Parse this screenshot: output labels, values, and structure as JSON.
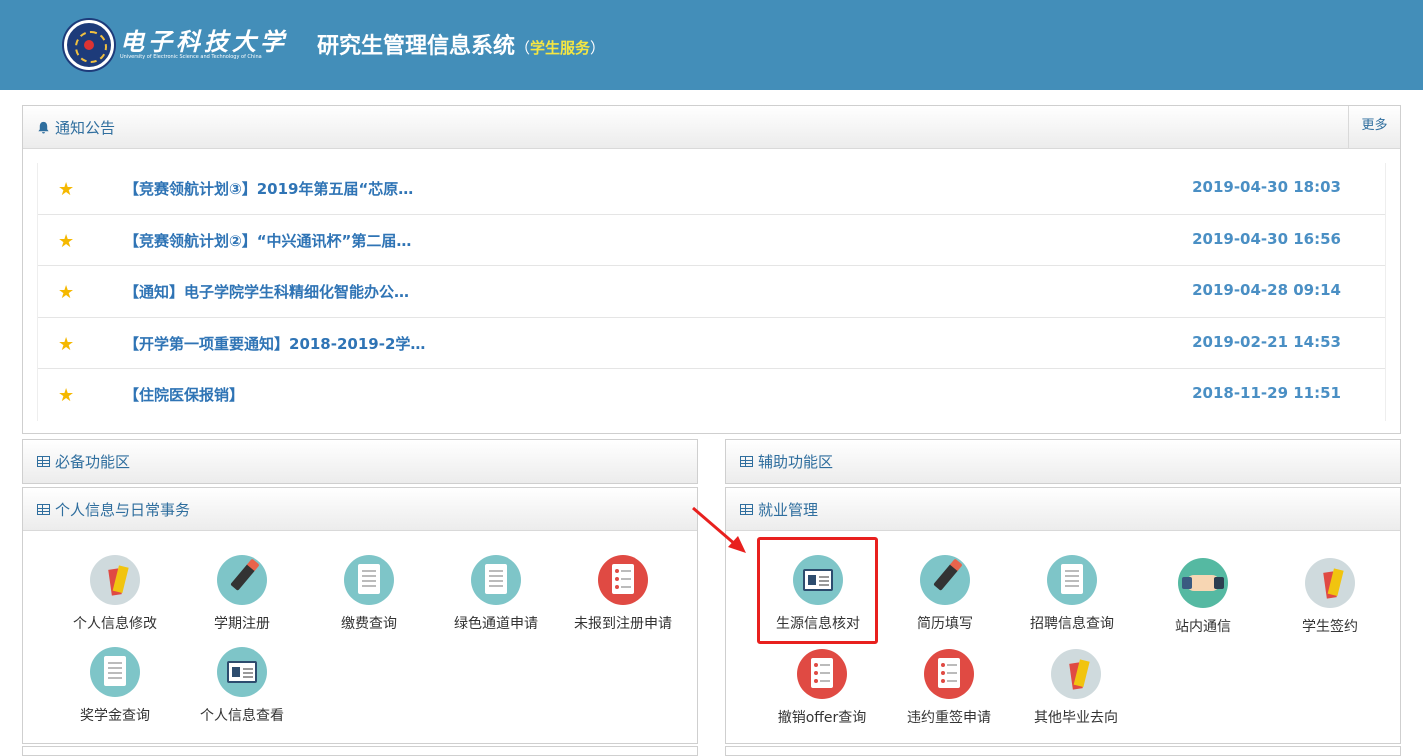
{
  "header": {
    "logo_cn": "电子科技大学",
    "logo_en": "University of Electronic Science and Technology of China",
    "title": "研究生管理信息系统",
    "sub_open": "（",
    "sub_label": "学生服务",
    "sub_close": "）"
  },
  "notice": {
    "title": "通知公告",
    "more": "更多",
    "items": [
      {
        "title": "【竞赛领航计划③】2019年第五届“芯原…",
        "date": "2019-04-30 18:03"
      },
      {
        "title": "【竞赛领航计划②】“中兴通讯杯”第二届…",
        "date": "2019-04-30 16:56"
      },
      {
        "title": "【通知】电子学院学生科精细化智能办公…",
        "date": "2019-04-28 09:14"
      },
      {
        "title": "【开学第一项重要通知】2018-2019-2学…",
        "date": "2019-02-21 14:53"
      },
      {
        "title": "【住院医保报销】",
        "date": "2018-11-29 11:51"
      }
    ]
  },
  "panels": {
    "required": "必备功能区",
    "auxiliary": "辅助功能区",
    "personal": "个人信息与日常事务",
    "employment": "就业管理"
  },
  "personal_items": [
    {
      "label": "个人信息修改",
      "icon": "color-swatch-icon"
    },
    {
      "label": "学期注册",
      "icon": "pen-icon"
    },
    {
      "label": "缴费查询",
      "icon": "document-icon"
    },
    {
      "label": "绿色通道申请",
      "icon": "document-icon"
    },
    {
      "label": "未报到注册申请",
      "icon": "resume-doc-icon"
    },
    {
      "label": "奖学金查询",
      "icon": "document-icon"
    },
    {
      "label": "个人信息查看",
      "icon": "id-card-icon"
    }
  ],
  "employment_items": [
    {
      "label": "生源信息核对",
      "icon": "id-card-icon"
    },
    {
      "label": "简历填写",
      "icon": "pen-icon"
    },
    {
      "label": "招聘信息查询",
      "icon": "document-icon"
    },
    {
      "label": "站内通信",
      "icon": "handshake-icon"
    },
    {
      "label": "学生签约",
      "icon": "color-swatch-icon"
    },
    {
      "label": "撤销offer查询",
      "icon": "resume-doc-icon"
    },
    {
      "label": "违约重签申请",
      "icon": "resume-doc-icon"
    },
    {
      "label": "其他毕业去向",
      "icon": "color-swatch-icon"
    }
  ],
  "colors": {
    "header_bg": "#438eb9",
    "accent_yellow": "#f5e642",
    "link_blue": "#2f74b5",
    "highlight_red": "#e8201e"
  }
}
